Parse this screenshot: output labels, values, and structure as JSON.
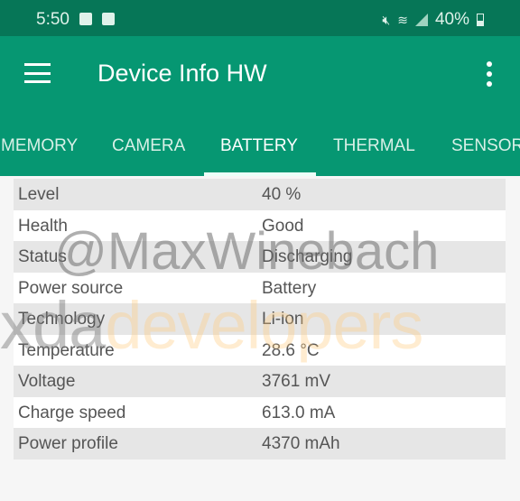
{
  "status_bar": {
    "time": "5:50",
    "battery": "40%",
    "icons": [
      "image-icon",
      "close-notification-icon",
      "mute-icon",
      "wifi-icon",
      "signal-icon",
      "battery-icon"
    ]
  },
  "app_bar": {
    "title": "Device Info HW",
    "menu_icon": "hamburger-menu-icon",
    "overflow_icon": "more-vert-icon"
  },
  "tabs": [
    {
      "label": "MEMORY"
    },
    {
      "label": "CAMERA"
    },
    {
      "label": "BATTERY",
      "active": true
    },
    {
      "label": "THERMAL"
    },
    {
      "label": "SENSORS"
    }
  ],
  "battery": [
    {
      "label": "Level",
      "value": "40 %"
    },
    {
      "label": "Health",
      "value": "Good"
    },
    {
      "label": "Status",
      "value": "Discharging"
    },
    {
      "label": "Power source",
      "value": "Battery"
    },
    {
      "label": "Technology",
      "value": "Li-ion"
    },
    {
      "label": "Temperature",
      "value": "28.6 °C"
    },
    {
      "label": "Voltage",
      "value": "3761 mV"
    },
    {
      "label": "Charge speed",
      "value": "613.0 mA"
    },
    {
      "label": "Power profile",
      "value": "4370 mAh"
    }
  ],
  "watermark": {
    "handle": "@MaxWinebach",
    "brand_a": "xda",
    "brand_b": "developers"
  },
  "colors": {
    "primary": "#069772",
    "status_bar": "#067657"
  }
}
